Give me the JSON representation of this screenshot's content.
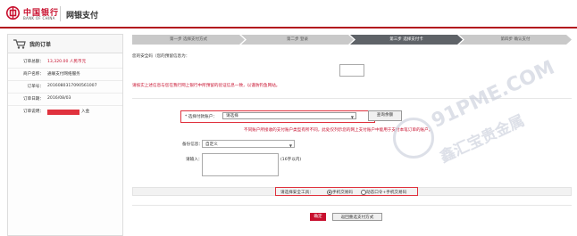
{
  "header": {
    "bank_name_cn": "中国银行",
    "bank_name_en": "BANK OF CHINA",
    "title": "网银支付"
  },
  "sidebar": {
    "title": "我的订单",
    "rows": [
      {
        "label": "订单总额：",
        "value": "13,320.00 人民币元",
        "value_color": "red"
      },
      {
        "label": "商户名称：",
        "value": "通联支付网络服务",
        "value_color": "default"
      },
      {
        "label": "订单号：",
        "value": "2016080317090561007",
        "value_color": "default"
      },
      {
        "label": "订单日期：",
        "value": "2016/08/03",
        "value_color": "default"
      },
      {
        "label": "订单说明：",
        "value_after_mask": "入金",
        "masked": true
      }
    ]
  },
  "steps": [
    "第一步 选择支付方式",
    "第二步 登录",
    "第三步 选择支付卡",
    "第四步 确认支付"
  ],
  "active_step_index": 2,
  "main": {
    "amount_prompt": "您的安全码（您的预留信息为：",
    "red_notice": "请核实上述信息与您在我行网上银行中所预留的验证信息一致，以谨防钓鱼网站。",
    "account_label": "* 选择付款账户：",
    "account_select_value": "请选择",
    "query_button": "查询余额",
    "red_notice2": "不同账户所接收的支付账户类型有所不同，此处仅列示您的网上支付账户中能用于支付本笔订单的账户。",
    "note_label": "备份信息：",
    "note_select_value": "自定义",
    "input_label": "请输入：",
    "limit_text": "(16字以内)",
    "security_label": "请选择安全工具：",
    "security_options": [
      {
        "label": "手机交易码",
        "selected": true
      },
      {
        "label": "动态口令+手机交易码",
        "selected": false
      }
    ],
    "confirm_button": "确定",
    "back_button": "返回重选支付方式"
  },
  "watermark": {
    "line1": "91PME.COM",
    "line2": "鑫汇宝贵金属"
  },
  "colors": {
    "brand_red": "#c8102e",
    "highlight_red": "#e0323e",
    "step_active": "#5f6368",
    "step_inactive": "#c9c9c9"
  }
}
